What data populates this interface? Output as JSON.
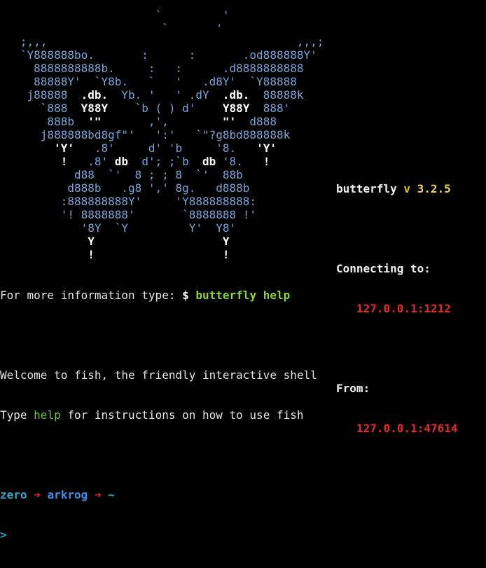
{
  "ascii_art": {
    "lines": [
      [
        {
          "t": "                       `         '",
          "w": false
        }
      ],
      [
        {
          "t": "                        `       '",
          "w": false
        }
      ],
      [
        {
          "t": "   ;,,,                                     ,,,;",
          "w": false
        }
      ],
      [
        {
          "t": "   `Y888888bo.       :      :       .od888888Y'",
          "w": false
        }
      ],
      [
        {
          "t": "     8888888888b.     :   :      .d8888888888",
          "w": false
        }
      ],
      [
        {
          "t": "     88888Y'  `Y8b.   `   '   .d8Y'  `Y88888",
          "w": false
        }
      ],
      [
        {
          "t": "    j88888  ",
          "w": false
        },
        {
          "t": ".db.",
          "w": true
        },
        {
          "t": "  Yb. '   ' .dY  ",
          "w": false
        },
        {
          "t": ".db.",
          "w": true
        },
        {
          "t": "  88888k",
          "w": false
        }
      ],
      [
        {
          "t": "      `888  ",
          "w": false
        },
        {
          "t": "Y88Y",
          "w": true
        },
        {
          "t": "    `b ( ) d'    ",
          "w": false
        },
        {
          "t": "Y88Y",
          "w": true
        },
        {
          "t": "  888'",
          "w": false
        }
      ],
      [
        {
          "t": "       888b  ",
          "w": false
        },
        {
          "t": "'\"",
          "w": true
        },
        {
          "t": "       ,',        ",
          "w": false
        },
        {
          "t": "\"'",
          "w": true
        },
        {
          "t": "  d888",
          "w": false
        }
      ],
      [
        {
          "t": "      j888888bd8gf\"'   ':'   `\"?g8bd888888k",
          "w": false
        }
      ],
      [
        {
          "t": "        ",
          "w": false
        },
        {
          "t": "'Y'",
          "w": true
        },
        {
          "t": "   .8'     d' 'b     '8.   ",
          "w": false
        },
        {
          "t": "'Y'",
          "w": true
        }
      ],
      [
        {
          "t": "         ",
          "w": false
        },
        {
          "t": "!",
          "w": true
        },
        {
          "t": "   .8' ",
          "w": false
        },
        {
          "t": "db",
          "w": true
        },
        {
          "t": "  d'; ;`b  ",
          "w": false
        },
        {
          "t": "db",
          "w": true
        },
        {
          "t": " '8.   ",
          "w": false
        },
        {
          "t": "!",
          "w": true
        }
      ],
      [
        {
          "t": "           d88  `'  8 ; ; 8  `'  88b",
          "w": false
        }
      ],
      [
        {
          "t": "          d888b   .g8 ',' 8g.   d888b",
          "w": false
        }
      ],
      [
        {
          "t": "         :888888888Y'     'Y888888888:",
          "w": false
        }
      ],
      [
        {
          "t": "         '! 8888888'       `8888888 !'",
          "w": false
        }
      ],
      [
        {
          "t": "            '8Y  `Y         Y'  Y8'",
          "w": false
        }
      ],
      [
        {
          "t": "             ",
          "w": false
        },
        {
          "t": "Y",
          "w": true
        },
        {
          "t": "                   ",
          "w": false
        },
        {
          "t": "Y",
          "w": true
        }
      ],
      [
        {
          "t": "             ",
          "w": false
        },
        {
          "t": "!",
          "w": true
        },
        {
          "t": "                   ",
          "w": false
        },
        {
          "t": "!",
          "w": true
        }
      ]
    ]
  },
  "info": {
    "name": "butterfly",
    "version_prefix": "v",
    "version": "3.2.5",
    "connecting_label": "Connecting to:",
    "connecting_addr": "127.0.0.1:1212",
    "from_label": "From:",
    "from_addr": "127.0.0.1:47614"
  },
  "messages": {
    "more_info_prefix": "For more information type: ",
    "dollar": "$",
    "help_command": "butterfly help",
    "welcome": "Welcome to fish, the friendly interactive shell",
    "type_prefix": "Type ",
    "help_word": "help",
    "type_suffix": " for instructions on how to use fish"
  },
  "prompt": {
    "user": "zero",
    "arrow": "➜",
    "host": "arkrog",
    "dir": "~",
    "cursor": ">"
  },
  "colors": {
    "background": "#000000",
    "ascii": "#7aa5d8",
    "accent_green": "#8bd43b",
    "accent_red": "#e32b2b",
    "accent_yellow": "#e5c300",
    "prompt_cyan": "#2aa7c9",
    "prompt_blue": "#3c8fe8"
  }
}
